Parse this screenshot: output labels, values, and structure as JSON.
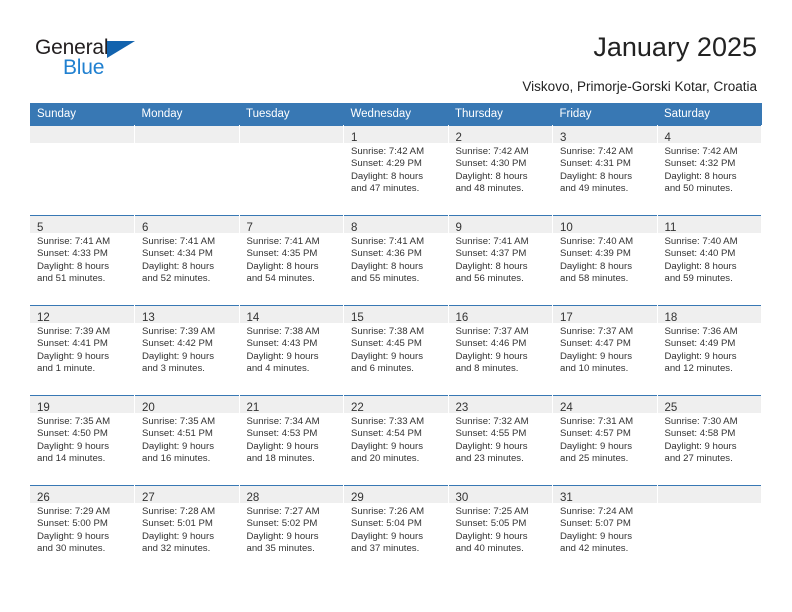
{
  "brand": {
    "name_part1": "General",
    "name_part2": "Blue",
    "triangle_icon": "triangle-icon",
    "accent_color": "#2080d0",
    "dark_color": "#231f20"
  },
  "header": {
    "title": "January 2025",
    "subtitle": "Viskovo, Primorje-Gorski Kotar, Croatia"
  },
  "calendar": {
    "header_bg": "#3878b4",
    "daynum_bg": "#efefef",
    "weekday_headers": [
      "Sunday",
      "Monday",
      "Tuesday",
      "Wednesday",
      "Thursday",
      "Friday",
      "Saturday"
    ],
    "weeks": [
      [
        {
          "day": "",
          "empty": true,
          "lines": []
        },
        {
          "day": "",
          "empty": true,
          "lines": []
        },
        {
          "day": "",
          "empty": true,
          "lines": []
        },
        {
          "day": "1",
          "empty": false,
          "lines": [
            "Sunrise: 7:42 AM",
            "Sunset: 4:29 PM",
            "Daylight: 8 hours",
            "and 47 minutes."
          ]
        },
        {
          "day": "2",
          "empty": false,
          "lines": [
            "Sunrise: 7:42 AM",
            "Sunset: 4:30 PM",
            "Daylight: 8 hours",
            "and 48 minutes."
          ]
        },
        {
          "day": "3",
          "empty": false,
          "lines": [
            "Sunrise: 7:42 AM",
            "Sunset: 4:31 PM",
            "Daylight: 8 hours",
            "and 49 minutes."
          ]
        },
        {
          "day": "4",
          "empty": false,
          "lines": [
            "Sunrise: 7:42 AM",
            "Sunset: 4:32 PM",
            "Daylight: 8 hours",
            "and 50 minutes."
          ]
        }
      ],
      [
        {
          "day": "5",
          "empty": false,
          "lines": [
            "Sunrise: 7:41 AM",
            "Sunset: 4:33 PM",
            "Daylight: 8 hours",
            "and 51 minutes."
          ]
        },
        {
          "day": "6",
          "empty": false,
          "lines": [
            "Sunrise: 7:41 AM",
            "Sunset: 4:34 PM",
            "Daylight: 8 hours",
            "and 52 minutes."
          ]
        },
        {
          "day": "7",
          "empty": false,
          "lines": [
            "Sunrise: 7:41 AM",
            "Sunset: 4:35 PM",
            "Daylight: 8 hours",
            "and 54 minutes."
          ]
        },
        {
          "day": "8",
          "empty": false,
          "lines": [
            "Sunrise: 7:41 AM",
            "Sunset: 4:36 PM",
            "Daylight: 8 hours",
            "and 55 minutes."
          ]
        },
        {
          "day": "9",
          "empty": false,
          "lines": [
            "Sunrise: 7:41 AM",
            "Sunset: 4:37 PM",
            "Daylight: 8 hours",
            "and 56 minutes."
          ]
        },
        {
          "day": "10",
          "empty": false,
          "lines": [
            "Sunrise: 7:40 AM",
            "Sunset: 4:39 PM",
            "Daylight: 8 hours",
            "and 58 minutes."
          ]
        },
        {
          "day": "11",
          "empty": false,
          "lines": [
            "Sunrise: 7:40 AM",
            "Sunset: 4:40 PM",
            "Daylight: 8 hours",
            "and 59 minutes."
          ]
        }
      ],
      [
        {
          "day": "12",
          "empty": false,
          "lines": [
            "Sunrise: 7:39 AM",
            "Sunset: 4:41 PM",
            "Daylight: 9 hours",
            "and 1 minute."
          ]
        },
        {
          "day": "13",
          "empty": false,
          "lines": [
            "Sunrise: 7:39 AM",
            "Sunset: 4:42 PM",
            "Daylight: 9 hours",
            "and 3 minutes."
          ]
        },
        {
          "day": "14",
          "empty": false,
          "lines": [
            "Sunrise: 7:38 AM",
            "Sunset: 4:43 PM",
            "Daylight: 9 hours",
            "and 4 minutes."
          ]
        },
        {
          "day": "15",
          "empty": false,
          "lines": [
            "Sunrise: 7:38 AM",
            "Sunset: 4:45 PM",
            "Daylight: 9 hours",
            "and 6 minutes."
          ]
        },
        {
          "day": "16",
          "empty": false,
          "lines": [
            "Sunrise: 7:37 AM",
            "Sunset: 4:46 PM",
            "Daylight: 9 hours",
            "and 8 minutes."
          ]
        },
        {
          "day": "17",
          "empty": false,
          "lines": [
            "Sunrise: 7:37 AM",
            "Sunset: 4:47 PM",
            "Daylight: 9 hours",
            "and 10 minutes."
          ]
        },
        {
          "day": "18",
          "empty": false,
          "lines": [
            "Sunrise: 7:36 AM",
            "Sunset: 4:49 PM",
            "Daylight: 9 hours",
            "and 12 minutes."
          ]
        }
      ],
      [
        {
          "day": "19",
          "empty": false,
          "lines": [
            "Sunrise: 7:35 AM",
            "Sunset: 4:50 PM",
            "Daylight: 9 hours",
            "and 14 minutes."
          ]
        },
        {
          "day": "20",
          "empty": false,
          "lines": [
            "Sunrise: 7:35 AM",
            "Sunset: 4:51 PM",
            "Daylight: 9 hours",
            "and 16 minutes."
          ]
        },
        {
          "day": "21",
          "empty": false,
          "lines": [
            "Sunrise: 7:34 AM",
            "Sunset: 4:53 PM",
            "Daylight: 9 hours",
            "and 18 minutes."
          ]
        },
        {
          "day": "22",
          "empty": false,
          "lines": [
            "Sunrise: 7:33 AM",
            "Sunset: 4:54 PM",
            "Daylight: 9 hours",
            "and 20 minutes."
          ]
        },
        {
          "day": "23",
          "empty": false,
          "lines": [
            "Sunrise: 7:32 AM",
            "Sunset: 4:55 PM",
            "Daylight: 9 hours",
            "and 23 minutes."
          ]
        },
        {
          "day": "24",
          "empty": false,
          "lines": [
            "Sunrise: 7:31 AM",
            "Sunset: 4:57 PM",
            "Daylight: 9 hours",
            "and 25 minutes."
          ]
        },
        {
          "day": "25",
          "empty": false,
          "lines": [
            "Sunrise: 7:30 AM",
            "Sunset: 4:58 PM",
            "Daylight: 9 hours",
            "and 27 minutes."
          ]
        }
      ],
      [
        {
          "day": "26",
          "empty": false,
          "lines": [
            "Sunrise: 7:29 AM",
            "Sunset: 5:00 PM",
            "Daylight: 9 hours",
            "and 30 minutes."
          ]
        },
        {
          "day": "27",
          "empty": false,
          "lines": [
            "Sunrise: 7:28 AM",
            "Sunset: 5:01 PM",
            "Daylight: 9 hours",
            "and 32 minutes."
          ]
        },
        {
          "day": "28",
          "empty": false,
          "lines": [
            "Sunrise: 7:27 AM",
            "Sunset: 5:02 PM",
            "Daylight: 9 hours",
            "and 35 minutes."
          ]
        },
        {
          "day": "29",
          "empty": false,
          "lines": [
            "Sunrise: 7:26 AM",
            "Sunset: 5:04 PM",
            "Daylight: 9 hours",
            "and 37 minutes."
          ]
        },
        {
          "day": "30",
          "empty": false,
          "lines": [
            "Sunrise: 7:25 AM",
            "Sunset: 5:05 PM",
            "Daylight: 9 hours",
            "and 40 minutes."
          ]
        },
        {
          "day": "31",
          "empty": false,
          "lines": [
            "Sunrise: 7:24 AM",
            "Sunset: 5:07 PM",
            "Daylight: 9 hours",
            "and 42 minutes."
          ]
        },
        {
          "day": "",
          "empty": true,
          "lines": []
        }
      ]
    ]
  }
}
